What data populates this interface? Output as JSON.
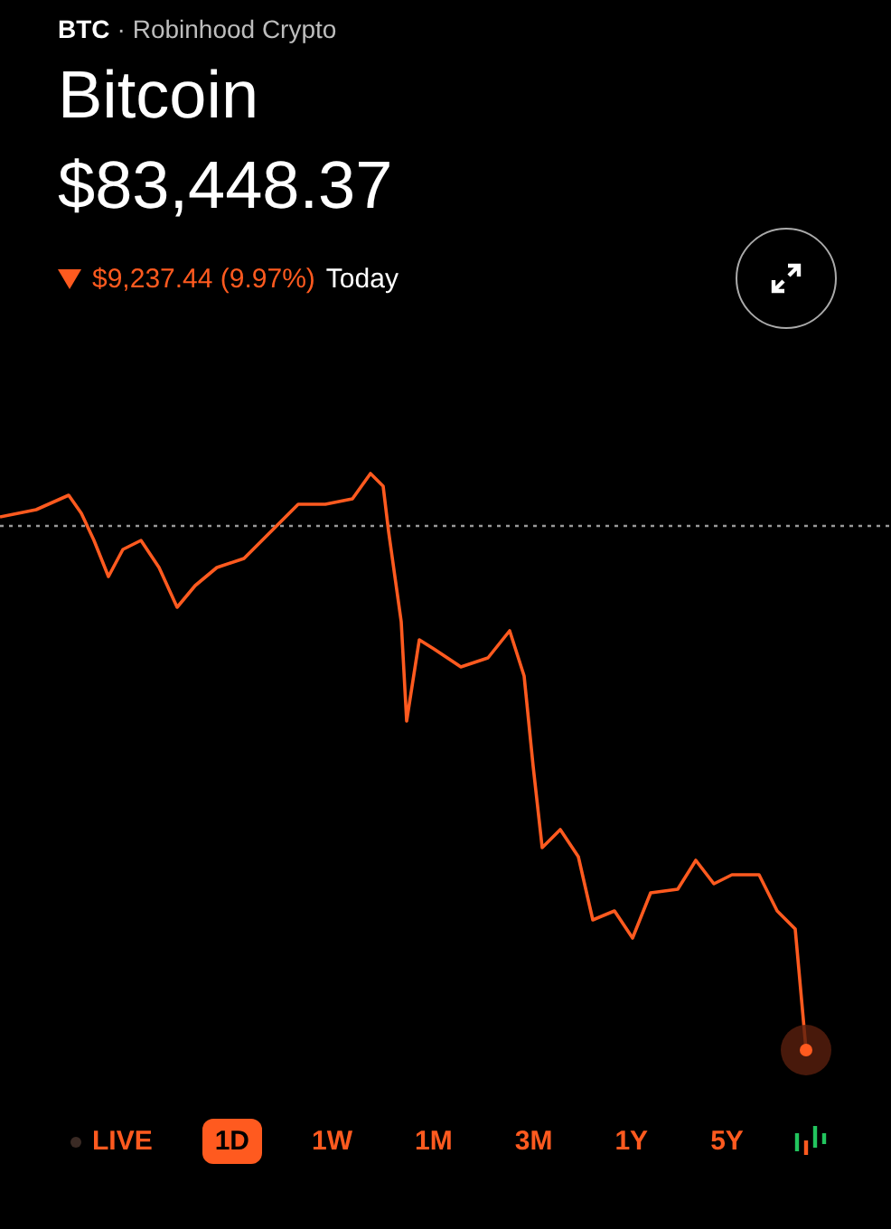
{
  "header": {
    "ticker": "BTC",
    "source": "· Robinhood Crypto",
    "name": "Bitcoin",
    "price": "$83,448.37",
    "change": "$9,237.44 (9.97%)",
    "period": "Today",
    "down": true
  },
  "ranges": [
    {
      "label": "LIVE",
      "kind": "live",
      "selected": false
    },
    {
      "label": "1D",
      "kind": "range",
      "selected": true
    },
    {
      "label": "1W",
      "kind": "range",
      "selected": false
    },
    {
      "label": "1M",
      "kind": "range",
      "selected": false
    },
    {
      "label": "3M",
      "kind": "range",
      "selected": false
    },
    {
      "label": "1Y",
      "kind": "range",
      "selected": false
    },
    {
      "label": "5Y",
      "kind": "range",
      "selected": false
    }
  ]
}
